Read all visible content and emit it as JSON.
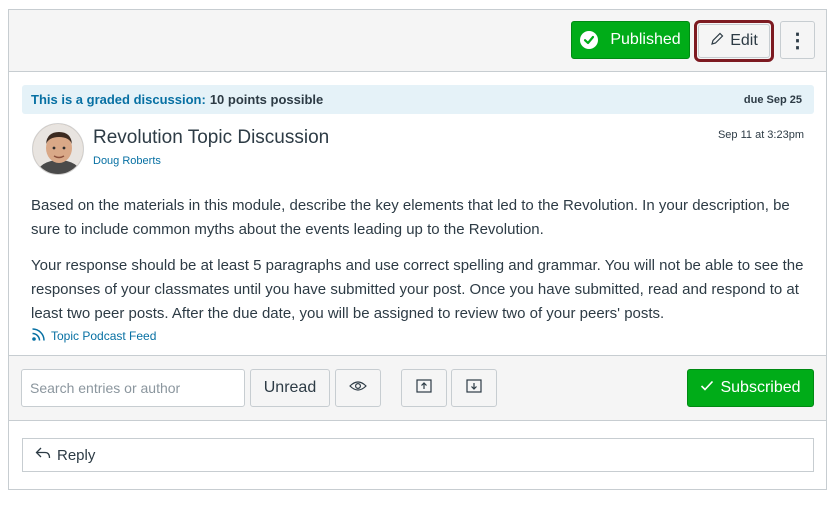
{
  "toolbar": {
    "published_label": "Published",
    "edit_label": "Edit",
    "more_label": "⋮"
  },
  "banner": {
    "graded_text": "This is a graded discussion:",
    "points_text": "10 points possible",
    "due_text": "due Sep 25"
  },
  "topic": {
    "title": "Revolution Topic Discussion",
    "author": "Doug Roberts",
    "date": "Sep 11 at 3:23pm",
    "paragraph1": "Based on the materials in this module, describe the key elements that led to the Revolution. In your description, be sure to include common myths about the events leading up to the Revolution.",
    "paragraph2": "Your response should be at least 5 paragraphs and use correct spelling and grammar. You will not be able to see the responses of your classmates until you have submitted your post. Once you have submitted, read and respond to at least two peer posts. After the due date, you will be assigned to review two of your peers' posts.",
    "podcast_label": "Topic Podcast Feed"
  },
  "filters": {
    "search_placeholder": "Search entries or author",
    "unread_label": "Unread",
    "subscribed_label": "Subscribed"
  },
  "reply": {
    "label": "Reply"
  },
  "colors": {
    "success": "#00ac18",
    "link": "#0770a3",
    "banner_bg": "#e5f2f8",
    "focus_ring": "#7d1a21"
  }
}
